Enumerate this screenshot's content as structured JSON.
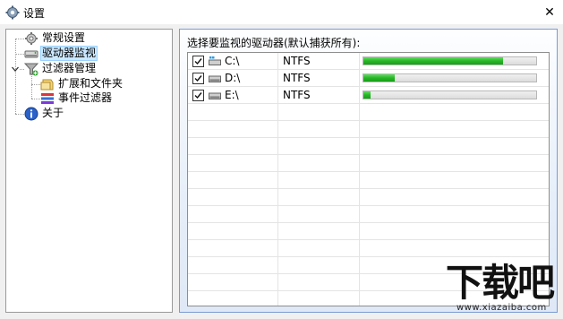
{
  "window": {
    "title": "设置",
    "close_glyph": "✕"
  },
  "tree": {
    "items": [
      {
        "label": "常规设置",
        "icon": "gear-icon"
      },
      {
        "label": "驱动器监视",
        "icon": "drive-icon",
        "selected": true
      },
      {
        "label": "过滤器管理",
        "icon": "filter-icon",
        "expanded": true
      },
      {
        "label": "扩展和文件夹",
        "icon": "folder-icon"
      },
      {
        "label": "事件过滤器",
        "icon": "event-filter-icon"
      },
      {
        "label": "关于",
        "icon": "info-icon"
      }
    ]
  },
  "panel": {
    "title": "选择要监视的驱动器(默认捕获所有):",
    "drives": [
      {
        "name": "C:\\",
        "fs": "NTFS",
        "checked": true,
        "usage": 0.81,
        "type": "system-drive"
      },
      {
        "name": "D:\\",
        "fs": "NTFS",
        "checked": true,
        "usage": 0.18,
        "type": "drive"
      },
      {
        "name": "E:\\",
        "fs": "NTFS",
        "checked": true,
        "usage": 0.04,
        "type": "drive"
      }
    ]
  },
  "watermark": {
    "text": "下载吧",
    "url": "www.xiazaiba.com"
  }
}
